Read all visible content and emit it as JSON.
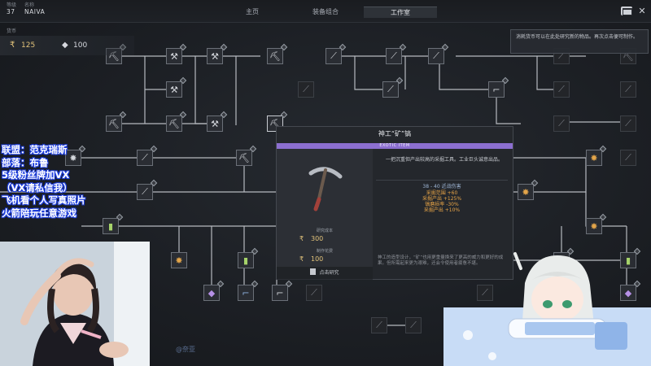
{
  "topbar": {
    "stats": [
      {
        "label": "等级",
        "value": "37"
      },
      {
        "label": "名称",
        "value": "NAIVA"
      }
    ],
    "tabs": [
      {
        "label": "主页",
        "active": false
      },
      {
        "label": "装备组合",
        "active": false
      },
      {
        "label": "工作室",
        "active": true
      }
    ],
    "icons": [
      "mail-icon",
      "close-icon"
    ],
    "close_glyph": "✕"
  },
  "currency": {
    "header": "货币",
    "items": [
      {
        "icon": "gold-currency-icon",
        "glyph": "₹",
        "value": "125"
      },
      {
        "icon": "crystal-currency-icon",
        "glyph": "◆",
        "value": "100"
      }
    ]
  },
  "hint_text": "消耗货币可以在此处研究新的物品。再次点击便可制作。",
  "item": {
    "title": "神工“矿”镐",
    "rarity": "EXOTIC ITEM",
    "description": "一把沉重但产出较高的采掘工具。工业巨头诚意出品。",
    "stats": [
      "38 - 40 近战伤害",
      "采掘范围 +60",
      "采掘产出 +125%",
      "镐磨损率 -30%",
      "采掘产出 +10%"
    ],
    "research_cost_label": "研究成本",
    "research_cost": "300",
    "craft_cost_label": "制作花费",
    "craft_cost": "100",
    "research_button": "点击研究",
    "lore": "神工的造型设计，“矿”也用更重量换来了更高的威力和更好的成果。但所需起来更为艰难，还会令使用者疲惫不堪。",
    "currency_glyph": "₹"
  },
  "overlay_lines": [
    "联盟：范克瑞斯",
    "部落：布鲁",
    "5级粉丝牌加VX",
    "（VX请私信我）",
    "飞机看个人写真照片",
    "火箭陪玩任意游戏"
  ],
  "vtuber_name": "@奈亚",
  "tree_nodes": [
    {
      "icon": "pickaxe-icon",
      "glyph": "⛏",
      "style": "normal"
    },
    {
      "icon": "wrench-icon",
      "glyph": "⚒",
      "style": "normal"
    },
    {
      "icon": "drill-icon",
      "glyph": "⚒",
      "style": "normal"
    },
    {
      "icon": "rifle-icon",
      "glyph": "⟋",
      "style": "normal"
    },
    {
      "icon": "blade-icon",
      "glyph": "⟋",
      "style": "normal"
    },
    {
      "icon": "grenade-icon",
      "glyph": "✸",
      "style": "orange"
    },
    {
      "icon": "ammo-icon",
      "glyph": "▮",
      "style": "green"
    },
    {
      "icon": "crystal-icon",
      "glyph": "◆",
      "style": "purple"
    },
    {
      "icon": "gun-icon",
      "glyph": "⌐",
      "style": "blue"
    }
  ]
}
